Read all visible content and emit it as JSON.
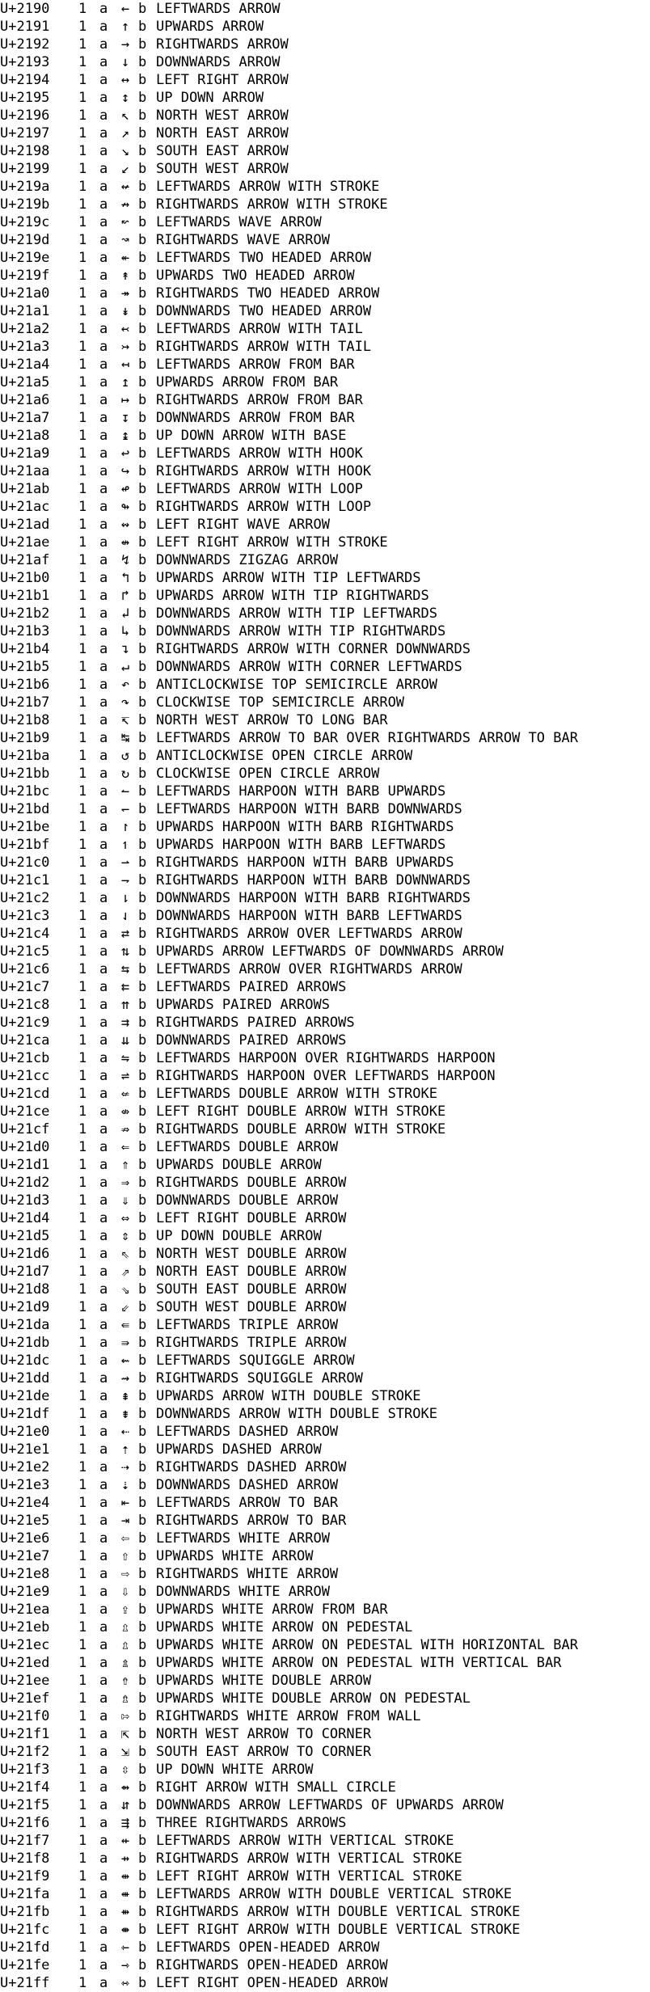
{
  "rows": [
    {
      "code": "U+2190",
      "n": "1",
      "a": "a",
      "ch": "←",
      "b": "b",
      "name": "LEFTWARDS ARROW"
    },
    {
      "code": "U+2191",
      "n": "1",
      "a": "a",
      "ch": "↑",
      "b": "b",
      "name": "UPWARDS ARROW"
    },
    {
      "code": "U+2192",
      "n": "1",
      "a": "a",
      "ch": "→",
      "b": "b",
      "name": "RIGHTWARDS ARROW"
    },
    {
      "code": "U+2193",
      "n": "1",
      "a": "a",
      "ch": "↓",
      "b": "b",
      "name": "DOWNWARDS ARROW"
    },
    {
      "code": "U+2194",
      "n": "1",
      "a": "a",
      "ch": "↔",
      "b": "b",
      "name": "LEFT RIGHT ARROW"
    },
    {
      "code": "U+2195",
      "n": "1",
      "a": "a",
      "ch": "↕",
      "b": "b",
      "name": "UP DOWN ARROW"
    },
    {
      "code": "U+2196",
      "n": "1",
      "a": "a",
      "ch": "↖",
      "b": "b",
      "name": "NORTH WEST ARROW"
    },
    {
      "code": "U+2197",
      "n": "1",
      "a": "a",
      "ch": "↗",
      "b": "b",
      "name": "NORTH EAST ARROW"
    },
    {
      "code": "U+2198",
      "n": "1",
      "a": "a",
      "ch": "↘",
      "b": "b",
      "name": "SOUTH EAST ARROW"
    },
    {
      "code": "U+2199",
      "n": "1",
      "a": "a",
      "ch": "↙",
      "b": "b",
      "name": "SOUTH WEST ARROW"
    },
    {
      "code": "U+219a",
      "n": "1",
      "a": "a",
      "ch": "↚",
      "b": "b",
      "name": "LEFTWARDS ARROW WITH STROKE"
    },
    {
      "code": "U+219b",
      "n": "1",
      "a": "a",
      "ch": "↛",
      "b": "b",
      "name": "RIGHTWARDS ARROW WITH STROKE"
    },
    {
      "code": "U+219c",
      "n": "1",
      "a": "a",
      "ch": "↜",
      "b": "b",
      "name": "LEFTWARDS WAVE ARROW"
    },
    {
      "code": "U+219d",
      "n": "1",
      "a": "a",
      "ch": "↝",
      "b": "b",
      "name": "RIGHTWARDS WAVE ARROW"
    },
    {
      "code": "U+219e",
      "n": "1",
      "a": "a",
      "ch": "↞",
      "b": "b",
      "name": "LEFTWARDS TWO HEADED ARROW"
    },
    {
      "code": "U+219f",
      "n": "1",
      "a": "a",
      "ch": "↟",
      "b": "b",
      "name": "UPWARDS TWO HEADED ARROW"
    },
    {
      "code": "U+21a0",
      "n": "1",
      "a": "a",
      "ch": "↠",
      "b": "b",
      "name": "RIGHTWARDS TWO HEADED ARROW"
    },
    {
      "code": "U+21a1",
      "n": "1",
      "a": "a",
      "ch": "↡",
      "b": "b",
      "name": "DOWNWARDS TWO HEADED ARROW"
    },
    {
      "code": "U+21a2",
      "n": "1",
      "a": "a",
      "ch": "↢",
      "b": "b",
      "name": "LEFTWARDS ARROW WITH TAIL"
    },
    {
      "code": "U+21a3",
      "n": "1",
      "a": "a",
      "ch": "↣",
      "b": "b",
      "name": "RIGHTWARDS ARROW WITH TAIL"
    },
    {
      "code": "U+21a4",
      "n": "1",
      "a": "a",
      "ch": "↤",
      "b": "b",
      "name": "LEFTWARDS ARROW FROM BAR"
    },
    {
      "code": "U+21a5",
      "n": "1",
      "a": "a",
      "ch": "↥",
      "b": "b",
      "name": "UPWARDS ARROW FROM BAR"
    },
    {
      "code": "U+21a6",
      "n": "1",
      "a": "a",
      "ch": "↦",
      "b": "b",
      "name": "RIGHTWARDS ARROW FROM BAR"
    },
    {
      "code": "U+21a7",
      "n": "1",
      "a": "a",
      "ch": "↧",
      "b": "b",
      "name": "DOWNWARDS ARROW FROM BAR"
    },
    {
      "code": "U+21a8",
      "n": "1",
      "a": "a",
      "ch": "↨",
      "b": "b",
      "name": "UP DOWN ARROW WITH BASE"
    },
    {
      "code": "U+21a9",
      "n": "1",
      "a": "a",
      "ch": "↩",
      "b": "b",
      "name": "LEFTWARDS ARROW WITH HOOK"
    },
    {
      "code": "U+21aa",
      "n": "1",
      "a": "a",
      "ch": "↪",
      "b": "b",
      "name": "RIGHTWARDS ARROW WITH HOOK"
    },
    {
      "code": "U+21ab",
      "n": "1",
      "a": "a",
      "ch": "↫",
      "b": "b",
      "name": "LEFTWARDS ARROW WITH LOOP"
    },
    {
      "code": "U+21ac",
      "n": "1",
      "a": "a",
      "ch": "↬",
      "b": "b",
      "name": "RIGHTWARDS ARROW WITH LOOP"
    },
    {
      "code": "U+21ad",
      "n": "1",
      "a": "a",
      "ch": "↭",
      "b": "b",
      "name": "LEFT RIGHT WAVE ARROW"
    },
    {
      "code": "U+21ae",
      "n": "1",
      "a": "a",
      "ch": "↮",
      "b": "b",
      "name": "LEFT RIGHT ARROW WITH STROKE"
    },
    {
      "code": "U+21af",
      "n": "1",
      "a": "a",
      "ch": "↯",
      "b": "b",
      "name": "DOWNWARDS ZIGZAG ARROW"
    },
    {
      "code": "U+21b0",
      "n": "1",
      "a": "a",
      "ch": "↰",
      "b": "b",
      "name": "UPWARDS ARROW WITH TIP LEFTWARDS"
    },
    {
      "code": "U+21b1",
      "n": "1",
      "a": "a",
      "ch": "↱",
      "b": "b",
      "name": "UPWARDS ARROW WITH TIP RIGHTWARDS"
    },
    {
      "code": "U+21b2",
      "n": "1",
      "a": "a",
      "ch": "↲",
      "b": "b",
      "name": "DOWNWARDS ARROW WITH TIP LEFTWARDS"
    },
    {
      "code": "U+21b3",
      "n": "1",
      "a": "a",
      "ch": "↳",
      "b": "b",
      "name": "DOWNWARDS ARROW WITH TIP RIGHTWARDS"
    },
    {
      "code": "U+21b4",
      "n": "1",
      "a": "a",
      "ch": "↴",
      "b": "b",
      "name": "RIGHTWARDS ARROW WITH CORNER DOWNWARDS"
    },
    {
      "code": "U+21b5",
      "n": "1",
      "a": "a",
      "ch": "↵",
      "b": "b",
      "name": "DOWNWARDS ARROW WITH CORNER LEFTWARDS"
    },
    {
      "code": "U+21b6",
      "n": "1",
      "a": "a",
      "ch": "↶",
      "b": "b",
      "name": "ANTICLOCKWISE TOP SEMICIRCLE ARROW"
    },
    {
      "code": "U+21b7",
      "n": "1",
      "a": "a",
      "ch": "↷",
      "b": "b",
      "name": "CLOCKWISE TOP SEMICIRCLE ARROW"
    },
    {
      "code": "U+21b8",
      "n": "1",
      "a": "a",
      "ch": "↸",
      "b": "b",
      "name": "NORTH WEST ARROW TO LONG BAR"
    },
    {
      "code": "U+21b9",
      "n": "1",
      "a": "a",
      "ch": "↹",
      "b": "b",
      "name": "LEFTWARDS ARROW TO BAR OVER RIGHTWARDS ARROW TO BAR"
    },
    {
      "code": "U+21ba",
      "n": "1",
      "a": "a",
      "ch": "↺",
      "b": "b",
      "name": "ANTICLOCKWISE OPEN CIRCLE ARROW"
    },
    {
      "code": "U+21bb",
      "n": "1",
      "a": "a",
      "ch": "↻",
      "b": "b",
      "name": "CLOCKWISE OPEN CIRCLE ARROW"
    },
    {
      "code": "U+21bc",
      "n": "1",
      "a": "a",
      "ch": "↼",
      "b": "b",
      "name": "LEFTWARDS HARPOON WITH BARB UPWARDS"
    },
    {
      "code": "U+21bd",
      "n": "1",
      "a": "a",
      "ch": "↽",
      "b": "b",
      "name": "LEFTWARDS HARPOON WITH BARB DOWNWARDS"
    },
    {
      "code": "U+21be",
      "n": "1",
      "a": "a",
      "ch": "↾",
      "b": "b",
      "name": "UPWARDS HARPOON WITH BARB RIGHTWARDS"
    },
    {
      "code": "U+21bf",
      "n": "1",
      "a": "a",
      "ch": "↿",
      "b": "b",
      "name": "UPWARDS HARPOON WITH BARB LEFTWARDS"
    },
    {
      "code": "U+21c0",
      "n": "1",
      "a": "a",
      "ch": "⇀",
      "b": "b",
      "name": "RIGHTWARDS HARPOON WITH BARB UPWARDS"
    },
    {
      "code": "U+21c1",
      "n": "1",
      "a": "a",
      "ch": "⇁",
      "b": "b",
      "name": "RIGHTWARDS HARPOON WITH BARB DOWNWARDS"
    },
    {
      "code": "U+21c2",
      "n": "1",
      "a": "a",
      "ch": "⇂",
      "b": "b",
      "name": "DOWNWARDS HARPOON WITH BARB RIGHTWARDS"
    },
    {
      "code": "U+21c3",
      "n": "1",
      "a": "a",
      "ch": "⇃",
      "b": "b",
      "name": "DOWNWARDS HARPOON WITH BARB LEFTWARDS"
    },
    {
      "code": "U+21c4",
      "n": "1",
      "a": "a",
      "ch": "⇄",
      "b": "b",
      "name": "RIGHTWARDS ARROW OVER LEFTWARDS ARROW"
    },
    {
      "code": "U+21c5",
      "n": "1",
      "a": "a",
      "ch": "⇅",
      "b": "b",
      "name": "UPWARDS ARROW LEFTWARDS OF DOWNWARDS ARROW"
    },
    {
      "code": "U+21c6",
      "n": "1",
      "a": "a",
      "ch": "⇆",
      "b": "b",
      "name": "LEFTWARDS ARROW OVER RIGHTWARDS ARROW"
    },
    {
      "code": "U+21c7",
      "n": "1",
      "a": "a",
      "ch": "⇇",
      "b": "b",
      "name": "LEFTWARDS PAIRED ARROWS"
    },
    {
      "code": "U+21c8",
      "n": "1",
      "a": "a",
      "ch": "⇈",
      "b": "b",
      "name": "UPWARDS PAIRED ARROWS"
    },
    {
      "code": "U+21c9",
      "n": "1",
      "a": "a",
      "ch": "⇉",
      "b": "b",
      "name": "RIGHTWARDS PAIRED ARROWS"
    },
    {
      "code": "U+21ca",
      "n": "1",
      "a": "a",
      "ch": "⇊",
      "b": "b",
      "name": "DOWNWARDS PAIRED ARROWS"
    },
    {
      "code": "U+21cb",
      "n": "1",
      "a": "a",
      "ch": "⇋",
      "b": "b",
      "name": "LEFTWARDS HARPOON OVER RIGHTWARDS HARPOON"
    },
    {
      "code": "U+21cc",
      "n": "1",
      "a": "a",
      "ch": "⇌",
      "b": "b",
      "name": "RIGHTWARDS HARPOON OVER LEFTWARDS HARPOON"
    },
    {
      "code": "U+21cd",
      "n": "1",
      "a": "a",
      "ch": "⇍",
      "b": "b",
      "name": "LEFTWARDS DOUBLE ARROW WITH STROKE"
    },
    {
      "code": "U+21ce",
      "n": "1",
      "a": "a",
      "ch": "⇎",
      "b": "b",
      "name": "LEFT RIGHT DOUBLE ARROW WITH STROKE"
    },
    {
      "code": "U+21cf",
      "n": "1",
      "a": "a",
      "ch": "⇏",
      "b": "b",
      "name": "RIGHTWARDS DOUBLE ARROW WITH STROKE"
    },
    {
      "code": "U+21d0",
      "n": "1",
      "a": "a",
      "ch": "⇐",
      "b": "b",
      "name": "LEFTWARDS DOUBLE ARROW"
    },
    {
      "code": "U+21d1",
      "n": "1",
      "a": "a",
      "ch": "⇑",
      "b": "b",
      "name": "UPWARDS DOUBLE ARROW"
    },
    {
      "code": "U+21d2",
      "n": "1",
      "a": "a",
      "ch": "⇒",
      "b": "b",
      "name": "RIGHTWARDS DOUBLE ARROW"
    },
    {
      "code": "U+21d3",
      "n": "1",
      "a": "a",
      "ch": "⇓",
      "b": "b",
      "name": "DOWNWARDS DOUBLE ARROW"
    },
    {
      "code": "U+21d4",
      "n": "1",
      "a": "a",
      "ch": "⇔",
      "b": "b",
      "name": "LEFT RIGHT DOUBLE ARROW"
    },
    {
      "code": "U+21d5",
      "n": "1",
      "a": "a",
      "ch": "⇕",
      "b": "b",
      "name": "UP DOWN DOUBLE ARROW"
    },
    {
      "code": "U+21d6",
      "n": "1",
      "a": "a",
      "ch": "⇖",
      "b": "b",
      "name": "NORTH WEST DOUBLE ARROW"
    },
    {
      "code": "U+21d7",
      "n": "1",
      "a": "a",
      "ch": "⇗",
      "b": "b",
      "name": "NORTH EAST DOUBLE ARROW"
    },
    {
      "code": "U+21d8",
      "n": "1",
      "a": "a",
      "ch": "⇘",
      "b": "b",
      "name": "SOUTH EAST DOUBLE ARROW"
    },
    {
      "code": "U+21d9",
      "n": "1",
      "a": "a",
      "ch": "⇙",
      "b": "b",
      "name": "SOUTH WEST DOUBLE ARROW"
    },
    {
      "code": "U+21da",
      "n": "1",
      "a": "a",
      "ch": "⇚",
      "b": "b",
      "name": "LEFTWARDS TRIPLE ARROW"
    },
    {
      "code": "U+21db",
      "n": "1",
      "a": "a",
      "ch": "⇛",
      "b": "b",
      "name": "RIGHTWARDS TRIPLE ARROW"
    },
    {
      "code": "U+21dc",
      "n": "1",
      "a": "a",
      "ch": "⇜",
      "b": "b",
      "name": "LEFTWARDS SQUIGGLE ARROW"
    },
    {
      "code": "U+21dd",
      "n": "1",
      "a": "a",
      "ch": "⇝",
      "b": "b",
      "name": "RIGHTWARDS SQUIGGLE ARROW"
    },
    {
      "code": "U+21de",
      "n": "1",
      "a": "a",
      "ch": "⇞",
      "b": "b",
      "name": "UPWARDS ARROW WITH DOUBLE STROKE"
    },
    {
      "code": "U+21df",
      "n": "1",
      "a": "a",
      "ch": "⇟",
      "b": "b",
      "name": "DOWNWARDS ARROW WITH DOUBLE STROKE"
    },
    {
      "code": "U+21e0",
      "n": "1",
      "a": "a",
      "ch": "⇠",
      "b": "b",
      "name": "LEFTWARDS DASHED ARROW"
    },
    {
      "code": "U+21e1",
      "n": "1",
      "a": "a",
      "ch": "⇡",
      "b": "b",
      "name": "UPWARDS DASHED ARROW"
    },
    {
      "code": "U+21e2",
      "n": "1",
      "a": "a",
      "ch": "⇢",
      "b": "b",
      "name": "RIGHTWARDS DASHED ARROW"
    },
    {
      "code": "U+21e3",
      "n": "1",
      "a": "a",
      "ch": "⇣",
      "b": "b",
      "name": "DOWNWARDS DASHED ARROW"
    },
    {
      "code": "U+21e4",
      "n": "1",
      "a": "a",
      "ch": "⇤",
      "b": "b",
      "name": "LEFTWARDS ARROW TO BAR"
    },
    {
      "code": "U+21e5",
      "n": "1",
      "a": "a",
      "ch": "⇥",
      "b": "b",
      "name": "RIGHTWARDS ARROW TO BAR"
    },
    {
      "code": "U+21e6",
      "n": "1",
      "a": "a",
      "ch": "⇦",
      "b": "b",
      "name": "LEFTWARDS WHITE ARROW"
    },
    {
      "code": "U+21e7",
      "n": "1",
      "a": "a",
      "ch": "⇧",
      "b": "b",
      "name": "UPWARDS WHITE ARROW"
    },
    {
      "code": "U+21e8",
      "n": "1",
      "a": "a",
      "ch": "⇨",
      "b": "b",
      "name": "RIGHTWARDS WHITE ARROW"
    },
    {
      "code": "U+21e9",
      "n": "1",
      "a": "a",
      "ch": "⇩",
      "b": "b",
      "name": "DOWNWARDS WHITE ARROW"
    },
    {
      "code": "U+21ea",
      "n": "1",
      "a": "a",
      "ch": "⇪",
      "b": "b",
      "name": "UPWARDS WHITE ARROW FROM BAR"
    },
    {
      "code": "U+21eb",
      "n": "1",
      "a": "a",
      "ch": "⇫",
      "b": "b",
      "name": "UPWARDS WHITE ARROW ON PEDESTAL"
    },
    {
      "code": "U+21ec",
      "n": "1",
      "a": "a",
      "ch": "⇬",
      "b": "b",
      "name": "UPWARDS WHITE ARROW ON PEDESTAL WITH HORIZONTAL BAR"
    },
    {
      "code": "U+21ed",
      "n": "1",
      "a": "a",
      "ch": "⇭",
      "b": "b",
      "name": "UPWARDS WHITE ARROW ON PEDESTAL WITH VERTICAL BAR"
    },
    {
      "code": "U+21ee",
      "n": "1",
      "a": "a",
      "ch": "⇮",
      "b": "b",
      "name": "UPWARDS WHITE DOUBLE ARROW"
    },
    {
      "code": "U+21ef",
      "n": "1",
      "a": "a",
      "ch": "⇯",
      "b": "b",
      "name": "UPWARDS WHITE DOUBLE ARROW ON PEDESTAL"
    },
    {
      "code": "U+21f0",
      "n": "1",
      "a": "a",
      "ch": "⇰",
      "b": "b",
      "name": "RIGHTWARDS WHITE ARROW FROM WALL"
    },
    {
      "code": "U+21f1",
      "n": "1",
      "a": "a",
      "ch": "⇱",
      "b": "b",
      "name": "NORTH WEST ARROW TO CORNER"
    },
    {
      "code": "U+21f2",
      "n": "1",
      "a": "a",
      "ch": "⇲",
      "b": "b",
      "name": "SOUTH EAST ARROW TO CORNER"
    },
    {
      "code": "U+21f3",
      "n": "1",
      "a": "a",
      "ch": "⇳",
      "b": "b",
      "name": "UP DOWN WHITE ARROW"
    },
    {
      "code": "U+21f4",
      "n": "1",
      "a": "a",
      "ch": "⇴",
      "b": "b",
      "name": "RIGHT ARROW WITH SMALL CIRCLE"
    },
    {
      "code": "U+21f5",
      "n": "1",
      "a": "a",
      "ch": "⇵",
      "b": "b",
      "name": "DOWNWARDS ARROW LEFTWARDS OF UPWARDS ARROW"
    },
    {
      "code": "U+21f6",
      "n": "1",
      "a": "a",
      "ch": "⇶",
      "b": "b",
      "name": "THREE RIGHTWARDS ARROWS"
    },
    {
      "code": "U+21f7",
      "n": "1",
      "a": "a",
      "ch": "⇷",
      "b": "b",
      "name": "LEFTWARDS ARROW WITH VERTICAL STROKE"
    },
    {
      "code": "U+21f8",
      "n": "1",
      "a": "a",
      "ch": "⇸",
      "b": "b",
      "name": "RIGHTWARDS ARROW WITH VERTICAL STROKE"
    },
    {
      "code": "U+21f9",
      "n": "1",
      "a": "a",
      "ch": "⇹",
      "b": "b",
      "name": "LEFT RIGHT ARROW WITH VERTICAL STROKE"
    },
    {
      "code": "U+21fa",
      "n": "1",
      "a": "a",
      "ch": "⇺",
      "b": "b",
      "name": "LEFTWARDS ARROW WITH DOUBLE VERTICAL STROKE"
    },
    {
      "code": "U+21fb",
      "n": "1",
      "a": "a",
      "ch": "⇻",
      "b": "b",
      "name": "RIGHTWARDS ARROW WITH DOUBLE VERTICAL STROKE"
    },
    {
      "code": "U+21fc",
      "n": "1",
      "a": "a",
      "ch": "⇼",
      "b": "b",
      "name": "LEFT RIGHT ARROW WITH DOUBLE VERTICAL STROKE"
    },
    {
      "code": "U+21fd",
      "n": "1",
      "a": "a",
      "ch": "⇽",
      "b": "b",
      "name": "LEFTWARDS OPEN-HEADED ARROW"
    },
    {
      "code": "U+21fe",
      "n": "1",
      "a": "a",
      "ch": "⇾",
      "b": "b",
      "name": "RIGHTWARDS OPEN-HEADED ARROW"
    },
    {
      "code": "U+21ff",
      "n": "1",
      "a": "a",
      "ch": "⇿",
      "b": "b",
      "name": "LEFT RIGHT OPEN-HEADED ARROW"
    }
  ]
}
